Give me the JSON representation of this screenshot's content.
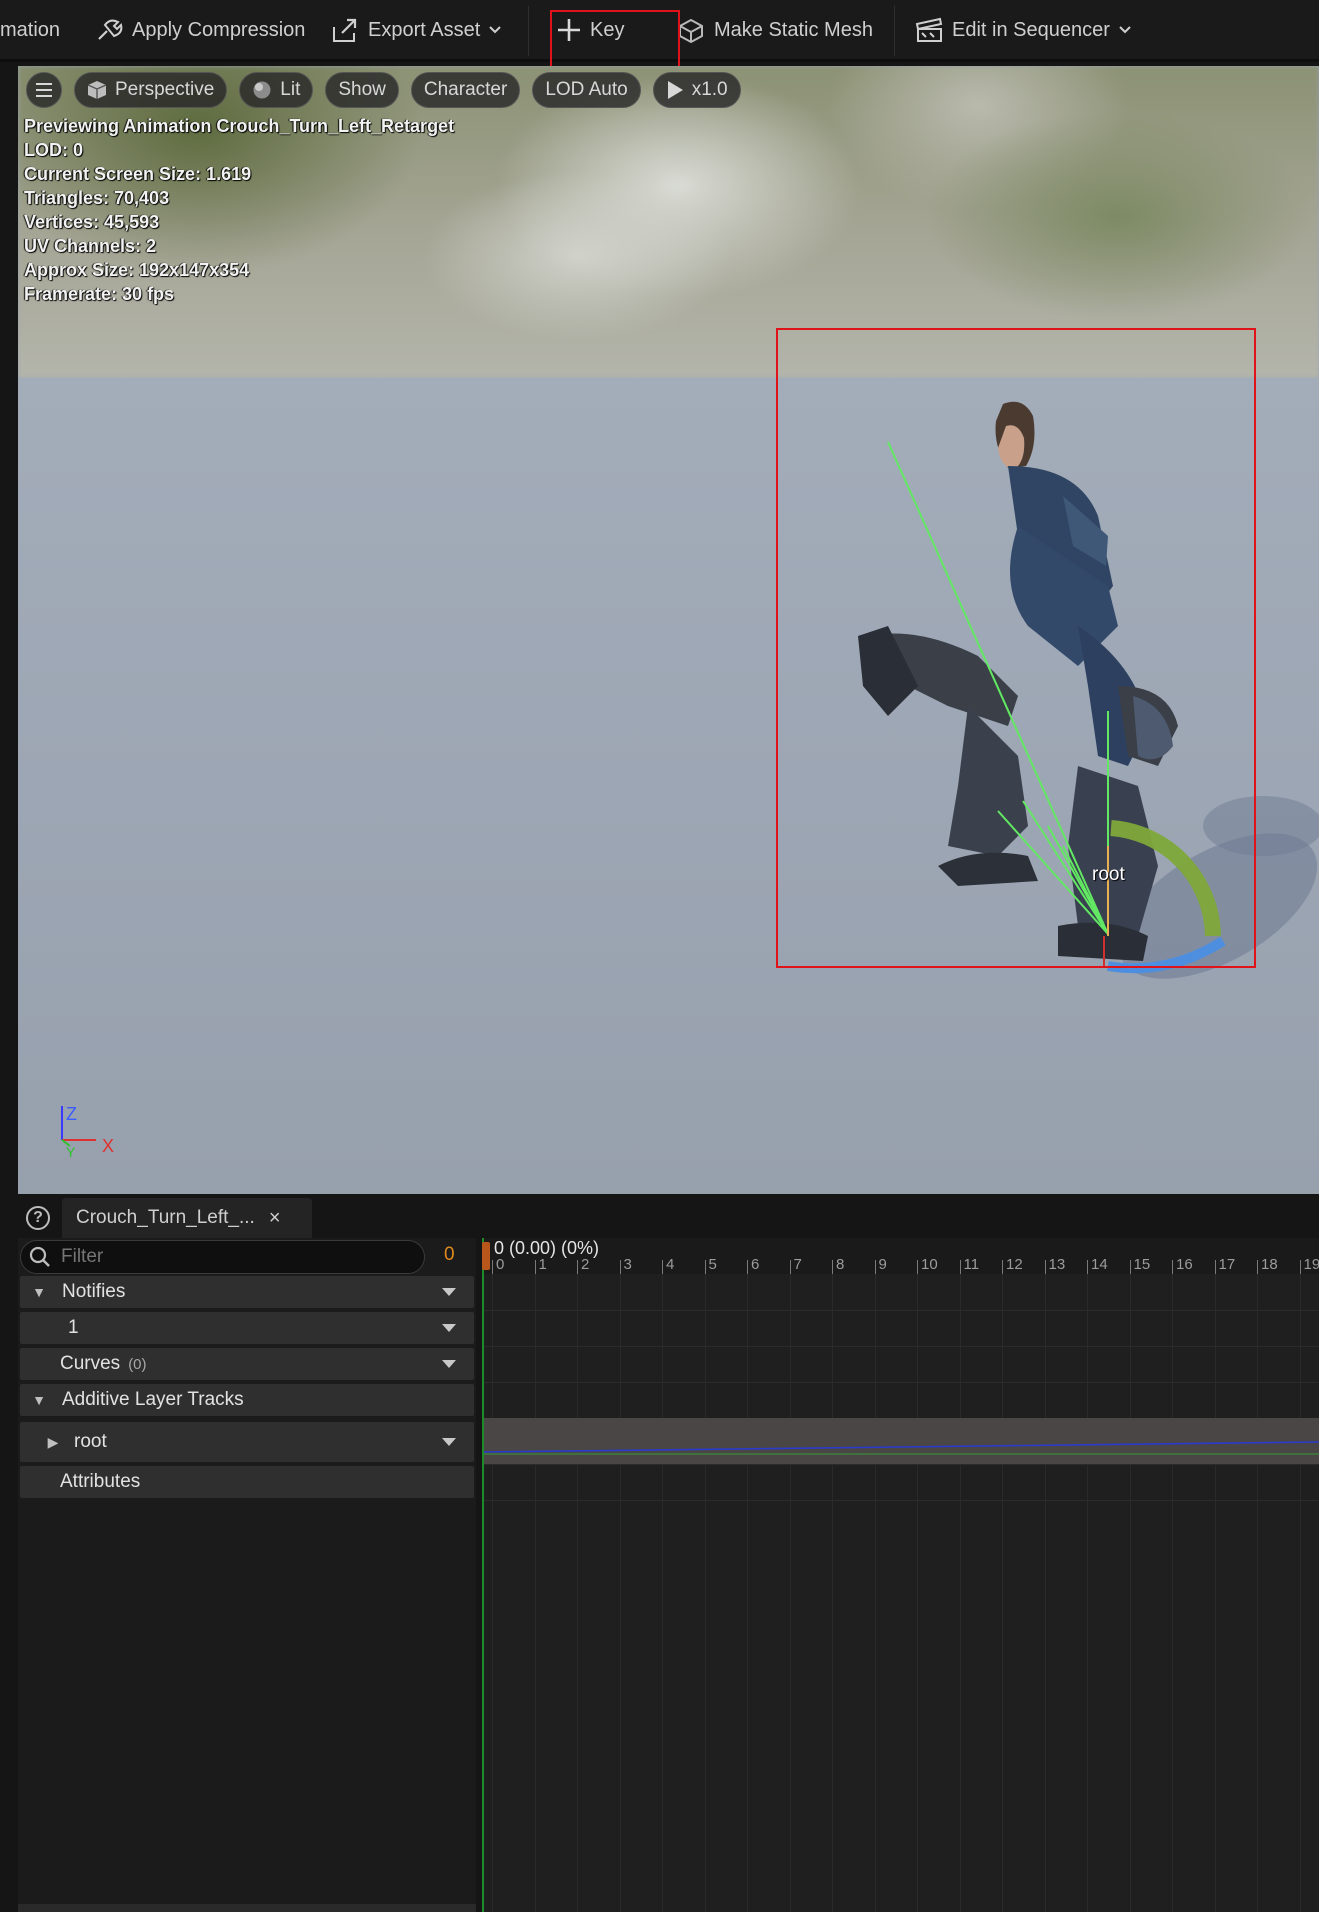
{
  "toolbar": {
    "items": [
      {
        "label": "mation",
        "icon": "none"
      },
      {
        "label": "Apply Compression",
        "icon": "compression-icon"
      },
      {
        "label": "Export Asset",
        "icon": "export-icon"
      },
      {
        "label": "Key",
        "icon": "plus-icon"
      },
      {
        "label": "Make Static Mesh",
        "icon": "static-mesh-icon"
      },
      {
        "label": "Edit in Sequencer",
        "icon": "sequencer-icon"
      }
    ]
  },
  "viewport": {
    "bar": {
      "perspective": "Perspective",
      "lit": "Lit",
      "show": "Show",
      "character": "Character",
      "lod": "LOD Auto",
      "speed": "x1.0"
    },
    "stats": [
      "Previewing Animation Crouch_Turn_Left_Retarget",
      "LOD: 0",
      "Current Screen Size: 1.619",
      "Triangles: 70,403",
      "Vertices: 45,593",
      "UV Channels: 2",
      "Approx Size: 192x147x354",
      "Framerate: 30 fps"
    ],
    "bone_label": "root",
    "axes": {
      "z": "Z",
      "y": "Y",
      "x": "X"
    }
  },
  "panel": {
    "tab_label": "Crouch_Turn_Left_...",
    "filter_placeholder": "Filter",
    "current_frame": "0",
    "tracks": {
      "notifies": "Notifies",
      "notify_track": "1",
      "curves": "Curves",
      "curves_count": "(0)",
      "additive": "Additive Layer Tracks",
      "root": "root",
      "attributes": "Attributes"
    },
    "timeline": {
      "time_display": "0 (0.00) (0%)",
      "ticks": [
        "0",
        "1",
        "2",
        "3",
        "4",
        "5",
        "6",
        "7",
        "8",
        "9",
        "10",
        "11",
        "12",
        "13",
        "14",
        "15",
        "16",
        "17",
        "18",
        "19"
      ]
    }
  },
  "colors": {
    "highlight": "#e0121a",
    "frame_accent": "#e08a1e",
    "playhead": "#1e8b2a"
  }
}
